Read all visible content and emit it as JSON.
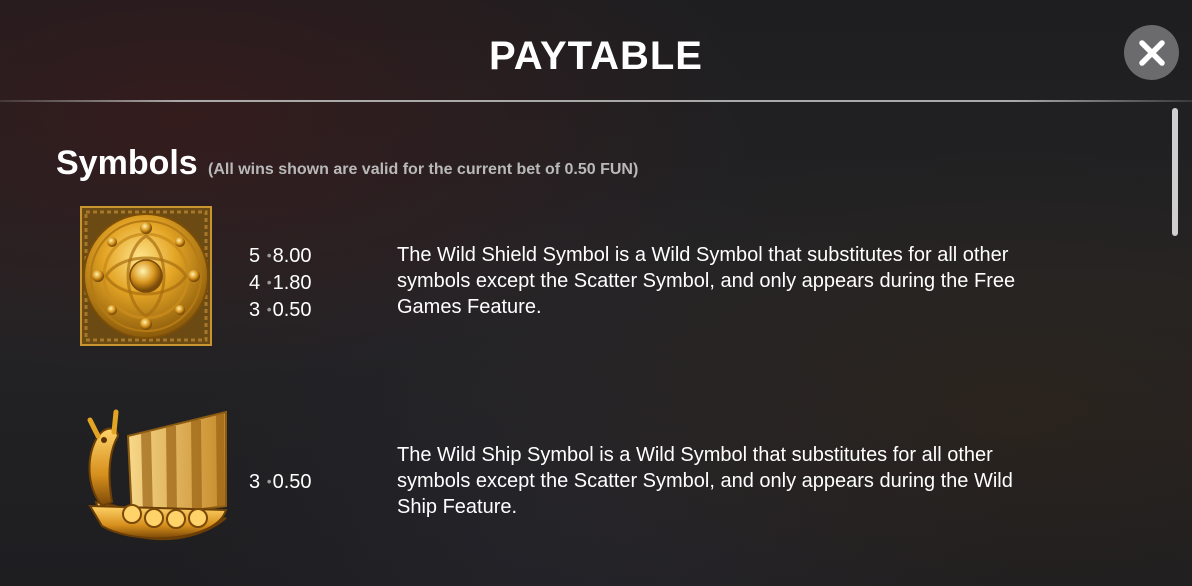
{
  "header": {
    "title": "PAYTABLE",
    "close_icon": "close-icon"
  },
  "symbols_section": {
    "title": "Symbols",
    "note": "(All wins shown are valid for the current bet of 0.50 FUN)",
    "items": [
      {
        "icon": "wild-shield-icon",
        "payouts": [
          {
            "count": "5",
            "value": "8.00"
          },
          {
            "count": "4",
            "value": "1.80"
          },
          {
            "count": "3",
            "value": "0.50"
          }
        ],
        "description": "The Wild Shield Symbol is a Wild Symbol that substitutes for all other symbols except the Scatter Symbol, and only appears during the Free Games Feature."
      },
      {
        "icon": "wild-ship-icon",
        "payouts": [
          {
            "count": "3",
            "value": "0.50"
          }
        ],
        "description": "The Wild Ship Symbol is a Wild Symbol that substitutes for all other symbols except the Scatter Symbol, and only appears during the Wild Ship Feature."
      }
    ]
  },
  "colors": {
    "background": "#1e1e20",
    "note_text": "#b9b9b9",
    "close_button": "#6b6b6d",
    "gold": "#e0a92a"
  }
}
